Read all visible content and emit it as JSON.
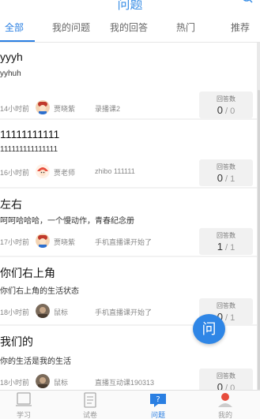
{
  "header": {
    "title": "问题"
  },
  "tabs": [
    {
      "label": "全部",
      "active": true
    },
    {
      "label": "我的问题",
      "active": false
    },
    {
      "label": "我的回答",
      "active": false
    },
    {
      "label": "热门",
      "active": false
    },
    {
      "label": "推荐",
      "active": false
    }
  ],
  "questions": [
    {
      "title": "yyyh",
      "desc": "yyhuh",
      "time": "14小时前",
      "author": "贾晓紫",
      "course": "录播课2",
      "answers_label": "回答数",
      "answers_count": "0",
      "answers_total": "0"
    },
    {
      "title": "11111111111",
      "desc": "111111111111111",
      "time": "16小时前",
      "author": "贾老师",
      "course": "zhibo 111111",
      "answers_label": "回答数",
      "answers_count": "0",
      "answers_total": "1"
    },
    {
      "title": "左右",
      "desc": "呵呵哈哈哈，一个慢动作，青春纪念册",
      "time": "17小时前",
      "author": "贾晓紫",
      "course": "手机直播课开始了",
      "answers_label": "回答数",
      "answers_count": "1",
      "answers_total": "1"
    },
    {
      "title": "你们右上角",
      "desc": "你们右上角的生活状态",
      "time": "18小时前",
      "author": "鼠标",
      "course": "手机直播课开始了",
      "answers_label": "回答数",
      "answers_count": "0",
      "answers_total": "1"
    },
    {
      "title": "我们的",
      "desc": "你的生活是我的生活",
      "time": "18小时前",
      "author": "鼠标",
      "course": "直播互动课190313",
      "answers_label": "回答数",
      "answers_count": "0",
      "answers_total": "0"
    }
  ],
  "fab": {
    "label": "问"
  },
  "bottom_nav": [
    {
      "label": "学习",
      "icon": "book-icon",
      "active": false
    },
    {
      "label": "试卷",
      "icon": "paper-icon",
      "active": false
    },
    {
      "label": "问题",
      "icon": "question-icon",
      "active": true
    },
    {
      "label": "我的",
      "icon": "profile-icon",
      "active": false
    }
  ],
  "colors": {
    "accent": "#2a7fe2",
    "fab": "#2f86e6",
    "divider": "#f2f2f2"
  }
}
